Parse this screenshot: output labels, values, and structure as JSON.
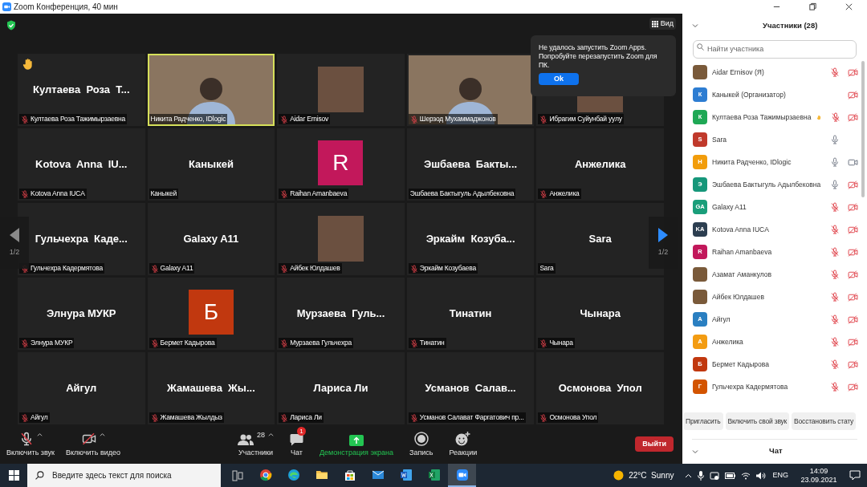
{
  "title_bar": {
    "title": "Zoom Конференция, 40 мин"
  },
  "view_button": {
    "label": "Вид"
  },
  "popup": {
    "message": "Не удалось запустить Zoom Apps. Попробуйте перезапустить Zoom для ПК.",
    "button": "Ok"
  },
  "tiles": [
    {
      "kind": "name",
      "display": "Култаева  Роза  Т...",
      "label": "Култаева Роза Тажимырзаевна",
      "muted": true,
      "hand_raised": true,
      "speaking": false
    },
    {
      "kind": "video",
      "label": "Никита Радченко, IDlogic",
      "muted": false,
      "hand_raised": false,
      "speaking": true
    },
    {
      "kind": "photo",
      "label": "Aidar Ernisov",
      "muted": true,
      "hand_raised": false,
      "speaking": false
    },
    {
      "kind": "video",
      "label": "Шерзод Мухаммаджонов",
      "muted": true,
      "hand_raised": false,
      "speaking": false
    },
    {
      "kind": "photo",
      "label": "Ибрагим Суйунбай уулу",
      "muted": true,
      "hand_raised": false,
      "speaking": false
    },
    {
      "kind": "name",
      "display": "Kotova  Anna  IU...",
      "label": "Kotova Anna IUCA",
      "muted": true,
      "hand_raised": false,
      "speaking": false
    },
    {
      "kind": "name",
      "display": "Каныкей",
      "label": "Каныкей",
      "muted": false,
      "hand_raised": false,
      "speaking": false
    },
    {
      "kind": "avatar",
      "display": "R",
      "color": "#c2185b",
      "label": "Raihan Amanbaeva",
      "muted": true,
      "hand_raised": false,
      "speaking": false
    },
    {
      "kind": "name",
      "display": "Эшбаева  Бакты...",
      "label": "Эшбаева Бактыгуль Адылбековна",
      "muted": false,
      "hand_raised": false,
      "speaking": false
    },
    {
      "kind": "name",
      "display": "Анжелика",
      "label": "Анжелика",
      "muted": true,
      "hand_raised": false,
      "speaking": false
    },
    {
      "kind": "name",
      "display": "Гульчехра  Каде...",
      "label": "Гульчехра Кадермятова",
      "muted": true,
      "hand_raised": false,
      "speaking": false
    },
    {
      "kind": "name",
      "display": "Galaxy A11",
      "label": "Galaxy A11",
      "muted": true,
      "hand_raised": false,
      "speaking": false
    },
    {
      "kind": "photo",
      "label": "Айбек Юлдашев",
      "muted": true,
      "hand_raised": false,
      "speaking": false
    },
    {
      "kind": "name",
      "display": "Эркайм  Козуба...",
      "label": "Эркайм Козубаева",
      "muted": true,
      "hand_raised": false,
      "speaking": false
    },
    {
      "kind": "name",
      "display": "Sara",
      "label": "Sara",
      "muted": false,
      "hand_raised": false,
      "speaking": false
    },
    {
      "kind": "name",
      "display": "Элнура МУКР",
      "label": "Элнура МУКР",
      "muted": true,
      "hand_raised": false,
      "speaking": false
    },
    {
      "kind": "avatar",
      "display": "Б",
      "color": "#c1380f",
      "label": "Бермет Кадырова",
      "muted": true,
      "hand_raised": false,
      "speaking": false
    },
    {
      "kind": "name",
      "display": "Мурзаева  Гуль...",
      "label": "Мурзаева Гульчехра",
      "muted": true,
      "hand_raised": false,
      "speaking": false
    },
    {
      "kind": "name",
      "display": "Тинатин",
      "label": "Тинатин",
      "muted": true,
      "hand_raised": false,
      "speaking": false
    },
    {
      "kind": "name",
      "display": "Чынара",
      "label": "Чынара",
      "muted": true,
      "hand_raised": false,
      "speaking": false
    },
    {
      "kind": "name",
      "display": "Айгул",
      "label": "Айгул",
      "muted": true,
      "hand_raised": false,
      "speaking": false
    },
    {
      "kind": "name",
      "display": "Жамашева  Жы...",
      "label": "Жамашева Жылдыз",
      "muted": true,
      "hand_raised": false,
      "speaking": false
    },
    {
      "kind": "name",
      "display": "Лариса Ли",
      "label": "Лариса Ли",
      "muted": true,
      "hand_raised": false,
      "speaking": false
    },
    {
      "kind": "name",
      "display": "Усманов  Салав...",
      "label": "Усманов Салават Фаргатович пр...",
      "muted": true,
      "hand_raised": false,
      "speaking": false
    },
    {
      "kind": "name",
      "display": "Осмонова  Упол",
      "label": "Осмонова  Упол",
      "muted": true,
      "hand_raised": false,
      "speaking": false
    }
  ],
  "pager": [
    {
      "kind": "prev",
      "label": "1/2",
      "enabled": false
    },
    {
      "kind": "next",
      "label": "1/2",
      "enabled": true
    }
  ],
  "toolbar": [
    {
      "kind": "audio",
      "label": "Включить звук"
    },
    {
      "kind": "video",
      "label": "Включить видео"
    },
    {
      "kind": "participants",
      "label": "Участники",
      "count": "28"
    },
    {
      "kind": "chat",
      "label": "Чат",
      "badge": "1"
    },
    {
      "kind": "share",
      "label": "Демонстрация экрана"
    },
    {
      "kind": "record",
      "label": "Запись"
    },
    {
      "kind": "reactions",
      "label": "Реакции"
    }
  ],
  "leave_button": {
    "label": "Выйти"
  },
  "participants_panel": {
    "title": "Участники (28)",
    "search": {
      "placeholder": "Найти участника"
    },
    "participants": [
      {
        "kind": "photo",
        "name": "Aidar Ernisov (Я)",
        "has_mic": true,
        "muted": true,
        "has_video": true,
        "video_on": false,
        "hand_raised": false
      },
      {
        "kind": "letter",
        "name": "Каныкей (Организатор)",
        "initials": "К",
        "color": "#2d7dd2",
        "has_mic": false,
        "has_video": true,
        "video_on": false,
        "hand_raised": false
      },
      {
        "kind": "letter",
        "name": "Култаева Роза Тажимырзаевна",
        "initials": "К",
        "color": "#1fa855",
        "has_mic": true,
        "muted": true,
        "has_video": true,
        "video_on": false,
        "hand_raised": true
      },
      {
        "kind": "letter",
        "name": "Sara",
        "initials": "S",
        "color": "#c0392b",
        "has_mic": true,
        "muted": false,
        "has_video": false,
        "hand_raised": false
      },
      {
        "kind": "letter",
        "name": "Никита Радченко, IDlogic",
        "initials": "Н",
        "color": "#f29d0b",
        "has_mic": true,
        "muted": false,
        "has_video": true,
        "video_on": true,
        "hand_raised": false
      },
      {
        "kind": "letter",
        "name": "Эшбаева Бактыгуль Адылбековна",
        "initials": "Э",
        "color": "#16977a",
        "has_mic": true,
        "muted": false,
        "has_video": true,
        "video_on": false,
        "hand_raised": false
      },
      {
        "kind": "letter",
        "name": "Galaxy A11",
        "initials": "GA",
        "color": "#1a9e7a",
        "has_mic": true,
        "muted": true,
        "has_video": true,
        "video_on": false,
        "hand_raised": false
      },
      {
        "kind": "letter",
        "name": "Kotova Anna IUCA",
        "initials": "KA",
        "color": "#2c3e50",
        "has_mic": true,
        "muted": true,
        "has_video": true,
        "video_on": false,
        "hand_raised": false
      },
      {
        "kind": "letter",
        "name": "Raihan Amanbaeva",
        "initials": "R",
        "color": "#c2185b",
        "has_mic": true,
        "muted": true,
        "has_video": true,
        "video_on": false,
        "hand_raised": false
      },
      {
        "kind": "photo",
        "name": "Азамат Аманкулов",
        "has_mic": true,
        "muted": true,
        "has_video": true,
        "video_on": false,
        "hand_raised": false
      },
      {
        "kind": "photo",
        "name": "Айбек Юлдашев",
        "has_mic": true,
        "muted": true,
        "has_video": true,
        "video_on": false,
        "hand_raised": false
      },
      {
        "kind": "letter",
        "name": "Айгул",
        "initials": "А",
        "color": "#2a7fc1",
        "has_mic": true,
        "muted": true,
        "has_video": true,
        "video_on": false,
        "hand_raised": false
      },
      {
        "kind": "letter",
        "name": "Анжелика",
        "initials": "А",
        "color": "#f39c12",
        "has_mic": true,
        "muted": true,
        "has_video": true,
        "video_on": false,
        "hand_raised": false
      },
      {
        "kind": "letter",
        "name": "Бермет Кадырова",
        "initials": "Б",
        "color": "#c1380f",
        "has_mic": true,
        "muted": true,
        "has_video": true,
        "video_on": false,
        "hand_raised": false
      },
      {
        "kind": "letter",
        "name": "Гульчехра Кадермятова",
        "initials": "Г",
        "color": "#d35400",
        "has_mic": true,
        "muted": true,
        "has_video": true,
        "video_on": false,
        "hand_raised": false
      }
    ],
    "buttons": [
      "Пригласить",
      "Включить свой звук",
      "Восстановить стату"
    ],
    "chat_title": "Чат"
  },
  "taskbar": {
    "search_placeholder": "Введите здесь текст для поиска",
    "weather": "22°C  Sunny",
    "language": "ENG",
    "time": "14:09",
    "date": "23.09.2021"
  }
}
